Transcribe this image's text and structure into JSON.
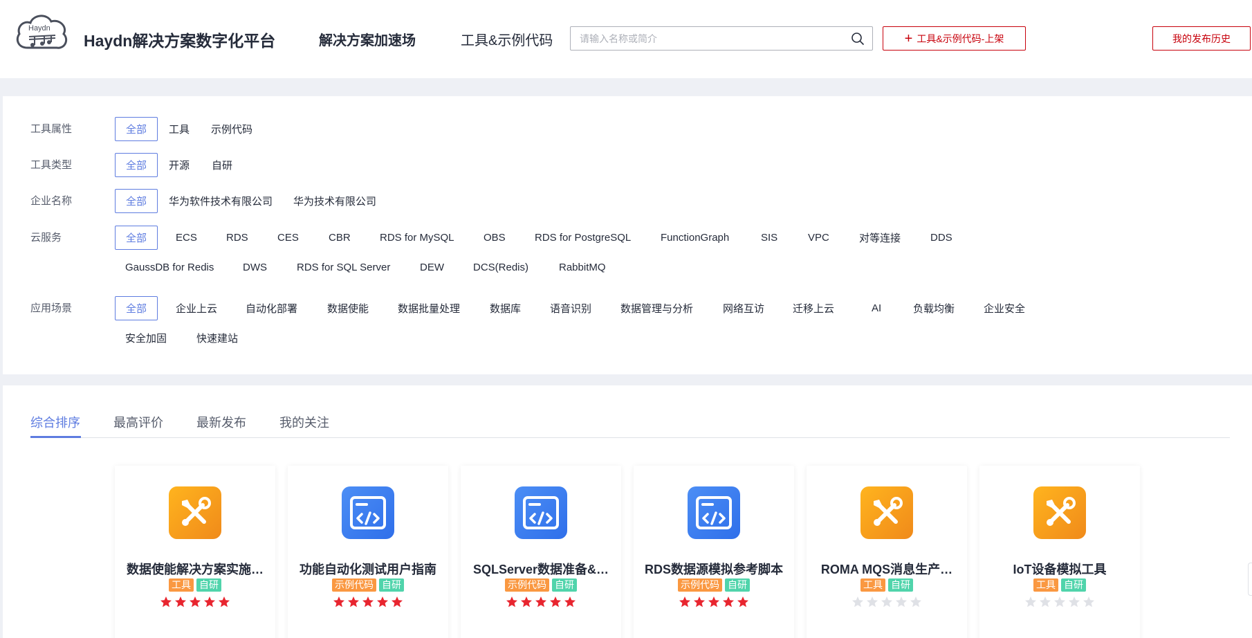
{
  "header": {
    "logo_text": "Haydn",
    "brand": "Haydn解决方案数字化平台",
    "nav": [
      "解决方案加速场",
      "工具&示例代码"
    ],
    "search_placeholder": "请输入名称或简介",
    "publish_label": "工具&示例代码-上架",
    "history_label": "我的发布历史"
  },
  "filters": {
    "attr": {
      "label": "工具属性",
      "options": [
        "全部",
        "工具",
        "示例代码"
      ]
    },
    "type": {
      "label": "工具类型",
      "options": [
        "全部",
        "开源",
        "自研"
      ]
    },
    "company": {
      "label": "企业名称",
      "options": [
        "全部",
        "华为软件技术有限公司",
        "华为技术有限公司"
      ]
    },
    "cloud": {
      "label": "云服务",
      "options": [
        "全部",
        "ECS",
        "RDS",
        "CES",
        "CBR",
        "RDS for MySQL",
        "OBS",
        "RDS for PostgreSQL",
        "FunctionGraph",
        "SIS",
        "VPC",
        "对等连接",
        "DDS",
        "GaussDB for Redis",
        "DWS",
        "RDS for SQL Server",
        "DEW",
        "DCS(Redis)",
        "RabbitMQ"
      ]
    },
    "scene": {
      "label": "应用场景",
      "options": [
        "全部",
        "企业上云",
        "自动化部署",
        "数据使能",
        "数据批量处理",
        "数据库",
        "语音识别",
        "数据管理与分析",
        "网络互访",
        "迁移上云",
        "AI",
        "负载均衡",
        "企业安全",
        "安全加固",
        "快速建站"
      ]
    }
  },
  "tabs": [
    "综合排序",
    "最高评价",
    "最新发布",
    "我的关注"
  ],
  "cards": [
    {
      "title": "数据使能解决方案实施…",
      "icon": "tool-icon",
      "tags": [
        "工具",
        "自研"
      ],
      "rating": 5
    },
    {
      "title": "功能自动化测试用户指南",
      "icon": "code-icon",
      "tags": [
        "示例代码",
        "自研"
      ],
      "rating": 5
    },
    {
      "title": "SQLServer数据准备&…",
      "icon": "code-icon",
      "tags": [
        "示例代码",
        "自研"
      ],
      "rating": 5
    },
    {
      "title": "RDS数据源模拟参考脚本",
      "icon": "code-icon",
      "tags": [
        "示例代码",
        "自研"
      ],
      "rating": 5
    },
    {
      "title": "ROMA MQS消息生产…",
      "icon": "tool-icon",
      "tags": [
        "工具",
        "自研"
      ],
      "rating": 0
    },
    {
      "title": "IoT设备模拟工具",
      "icon": "tool-icon",
      "tags": [
        "工具",
        "自研"
      ],
      "rating": 0
    }
  ],
  "colors": {
    "accent": "#5e7ce0",
    "brand_red": "#c7000b",
    "tag_orange": "#fa9841",
    "tag_green": "#50d4ab",
    "star_red": "#e8252f",
    "star_empty": "#dfe1e6"
  }
}
